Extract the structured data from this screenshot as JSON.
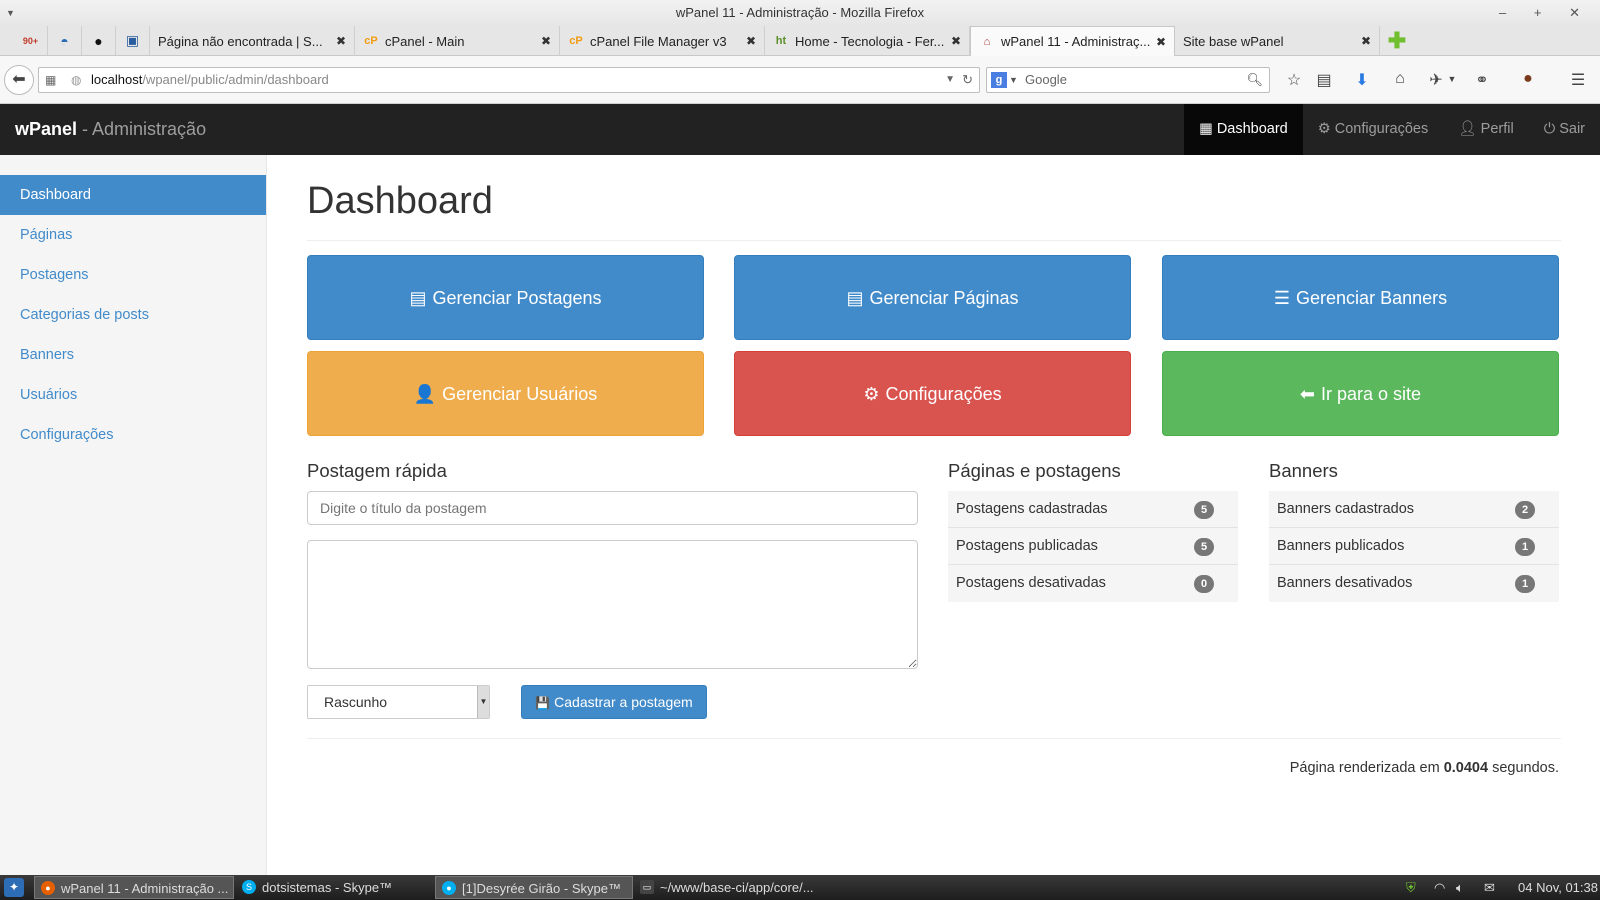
{
  "window": {
    "title": "wPanel 11 - Administração - Mozilla Firefox",
    "controls": "– + ✕"
  },
  "tabs": [
    {
      "label": "Página não encontrada | S...",
      "icon": "page-icon",
      "active": false
    },
    {
      "label": "cPanel - Main",
      "icon": "cpanel-icon",
      "active": false
    },
    {
      "label": "cPanel File Manager v3",
      "icon": "cpanel-icon",
      "active": false
    },
    {
      "label": "Home - Tecnologia - Fer...",
      "icon": "site-icon",
      "active": false
    },
    {
      "label": "wPanel 11 - Administraç...",
      "icon": "home-icon",
      "active": true
    },
    {
      "label": "Site base wPanel",
      "icon": "none",
      "active": false
    }
  ],
  "pinned": {
    "gmail_count": "90+"
  },
  "urlbar": {
    "host": "localhost",
    "path": "/wpanel/public/admin/dashboard"
  },
  "searchbar": {
    "engine": "g",
    "placeholder": "Google"
  },
  "app": {
    "brand_name": "wPanel",
    "brand_sub": " - Administração",
    "topnav": [
      {
        "label": "Dashboard",
        "icon": "grid-icon"
      },
      {
        "label": "Configurações",
        "icon": "gear-icon"
      },
      {
        "label": "Perfil",
        "icon": "user-icon"
      },
      {
        "label": "Sair",
        "icon": "power-icon"
      }
    ]
  },
  "sidebar": {
    "items": [
      {
        "label": "Dashboard",
        "active": true
      },
      {
        "label": "Páginas"
      },
      {
        "label": "Postagens"
      },
      {
        "label": "Categorias de posts"
      },
      {
        "label": "Banners"
      },
      {
        "label": "Usuários"
      },
      {
        "label": "Configurações"
      }
    ]
  },
  "main": {
    "title": "Dashboard",
    "tiles": [
      {
        "label": "Gerenciar Postagens",
        "glyph": "▤"
      },
      {
        "label": "Gerenciar Páginas",
        "glyph": "▤"
      },
      {
        "label": "Gerenciar Banners",
        "glyph": "☰"
      },
      {
        "label": "Gerenciar Usuários",
        "glyph": "👤"
      },
      {
        "label": "Configurações",
        "glyph": "⚙"
      },
      {
        "label": "Ir para o site",
        "glyph": "⬅"
      }
    ],
    "quickpost": {
      "heading": "Postagem rápida",
      "title_placeholder": "Digite o título da postagem",
      "status_value": "Rascunho",
      "submit_label": "Cadastrar a postagem",
      "submit_glyph": "💾"
    },
    "pages_posts": {
      "heading": "Páginas e postagens",
      "items": [
        {
          "label": "Postagens cadastradas",
          "count": "5"
        },
        {
          "label": "Postagens publicadas",
          "count": "5"
        },
        {
          "label": "Postagens desativadas",
          "count": "0"
        }
      ]
    },
    "banners": {
      "heading": "Banners",
      "items": [
        {
          "label": "Banners cadastrados",
          "count": "2"
        },
        {
          "label": "Banners publicados",
          "count": "1"
        },
        {
          "label": "Banners desativados",
          "count": "1"
        }
      ]
    },
    "footer": {
      "prefix": "Página renderizada em ",
      "time": "0.0404",
      "suffix": " segundos."
    }
  },
  "taskbar": {
    "items": [
      {
        "label": "wPanel 11 - Administração ...",
        "active": true
      },
      {
        "label": "dotsistemas - Skype™"
      },
      {
        "label": "[1]Desyrée Girão - Skype™"
      },
      {
        "label": "~/www/base-ci/app/core/..."
      }
    ],
    "clock": "04 Nov, 01:38"
  },
  "colors": {
    "primary": "#428bca",
    "warning": "#f0ad4e",
    "danger": "#d9534f",
    "success": "#5cb85c",
    "header": "#222222"
  }
}
